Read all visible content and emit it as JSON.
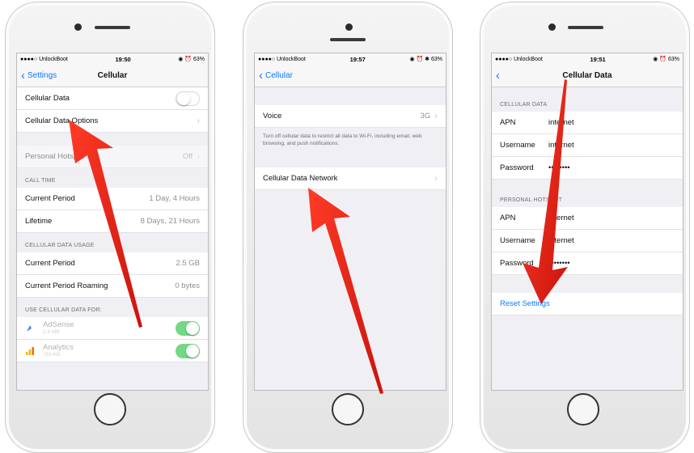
{
  "colors": {
    "ios_blue": "#0a7aff",
    "arrow_red": "#e8201a",
    "toggle_green": "#72d985"
  },
  "phones": [
    {
      "status": {
        "carrier": "●●●●○ UnlockBoot",
        "wifi": "wifi-icon",
        "time": "19:50",
        "right": "◉ ⏰ 63%"
      },
      "nav": {
        "back": "Settings",
        "title": "Cellular"
      },
      "rows": {
        "cellular_data": "Cellular Data",
        "cellular_data_options": "Cellular Data Options",
        "personal_hotspot": "Personal Hotspot",
        "personal_hotspot_value": "Off",
        "call_time_header": "CALL TIME",
        "current_period": "Current Period",
        "current_period_value": "1 Day, 4 Hours",
        "lifetime": "Lifetime",
        "lifetime_value": "8 Days, 21 Hours",
        "usage_header": "CELLULAR DATA USAGE",
        "usage_current_period": "Current Period",
        "usage_current_period_value": "2.5 GB",
        "usage_roaming": "Current Period Roaming",
        "usage_roaming_value": "0 bytes",
        "use_for_header": "USE CELLULAR DATA FOR:"
      },
      "apps": [
        {
          "name": "AdSense",
          "size": "1.4 MB",
          "icon": "adsense-icon"
        },
        {
          "name": "Analytics",
          "size": "763 KB",
          "icon": "analytics-icon"
        }
      ]
    },
    {
      "status": {
        "carrier": "●●●●○ UnlockBoot",
        "wifi": "wifi-icon",
        "time": "19:57",
        "right": "◉ ⏰ ✱ 63%"
      },
      "nav": {
        "back": "Cellular",
        "title": ""
      },
      "rows": {
        "voice": "Voice",
        "voice_value": "3G",
        "note": "Turn off cellular data to restrict all data to Wi-Fi, including email, web browsing, and push notifications.",
        "cellular_data_network": "Cellular Data Network"
      }
    },
    {
      "status": {
        "carrier": "●●●●○ UnlockBoot",
        "wifi": "wifi-icon",
        "time": "19:51",
        "right": "◉ ⏰ 63%"
      },
      "nav": {
        "back": "",
        "title": "Cellular Data"
      },
      "rows": {
        "cellular_data_header": "CELLULAR DATA",
        "apn": "APN",
        "apn_value": "internet",
        "username": "Username",
        "username_value": "internet",
        "password": "Password",
        "password_value": "••••••••",
        "hotspot_header": "PERSONAL HOTSPOT",
        "hs_apn": "APN",
        "hs_apn_value": "internet",
        "hs_username": "Username",
        "hs_username_value": "internet",
        "hs_password": "Password",
        "hs_password_value": "••••••••",
        "reset": "Reset Settings"
      }
    }
  ]
}
